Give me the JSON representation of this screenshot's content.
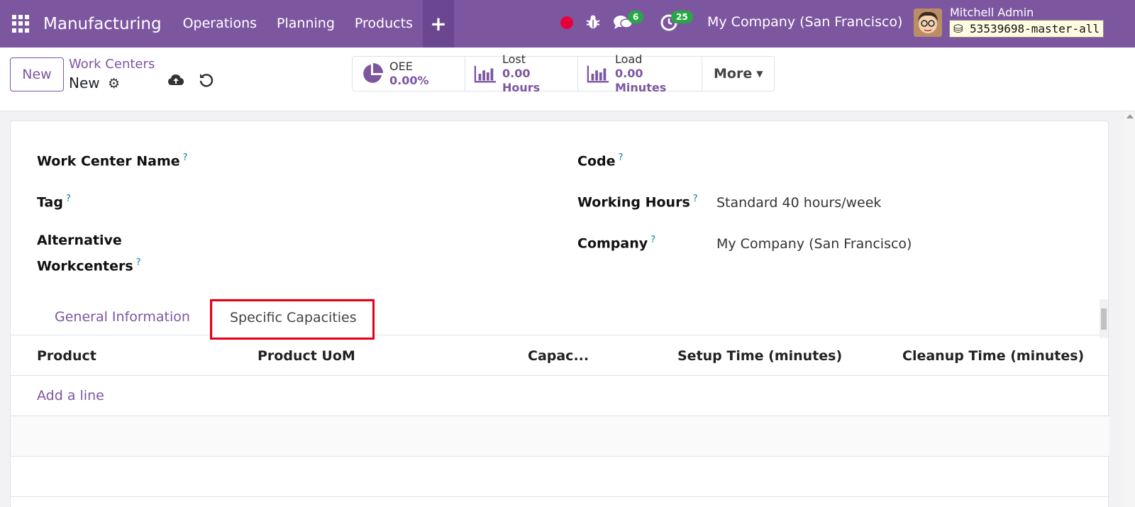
{
  "navbar": {
    "brand": "Manufacturing",
    "menu": [
      "Operations",
      "Planning",
      "Products"
    ],
    "plus_label": "+",
    "messages_badge": "6",
    "activities_badge": "25",
    "company": "My Company (San Francisco)",
    "user_name": "Mitchell Admin",
    "db_name": "53539698-master-all"
  },
  "control": {
    "new_label": "New",
    "breadcrumb_parent": "Work Centers",
    "breadcrumb_current": "New",
    "stats": [
      {
        "label": "OEE",
        "value": "0.00%",
        "icon": "pie-chart-icon"
      },
      {
        "label": "Lost",
        "value": "0.00 Hours",
        "icon": "bar-chart-icon"
      },
      {
        "label": "Load",
        "value": "0.00 Minutes",
        "icon": "bar-chart-icon"
      }
    ],
    "more_label": "More"
  },
  "form": {
    "work_center_name_label": "Work Center Name",
    "tag_label": "Tag",
    "alt_workcenters_label_1": "Alternative",
    "alt_workcenters_label_2": "Workcenters",
    "code_label": "Code",
    "working_hours_label": "Working Hours",
    "working_hours_value": "Standard 40 hours/week",
    "company_label": "Company",
    "company_value": "My Company (San Francisco)",
    "help_mark": "?"
  },
  "tabs": {
    "general": "General Information",
    "specific": "Specific Capacities"
  },
  "table": {
    "headers": [
      "Product",
      "Product UoM",
      "Capac...",
      "Setup Time (minutes)",
      "Cleanup Time (minutes)"
    ],
    "add_line": "Add a line"
  },
  "colors": {
    "brand": "#7d56a0",
    "highlight": "#e5001a",
    "badge": "#28a745"
  }
}
